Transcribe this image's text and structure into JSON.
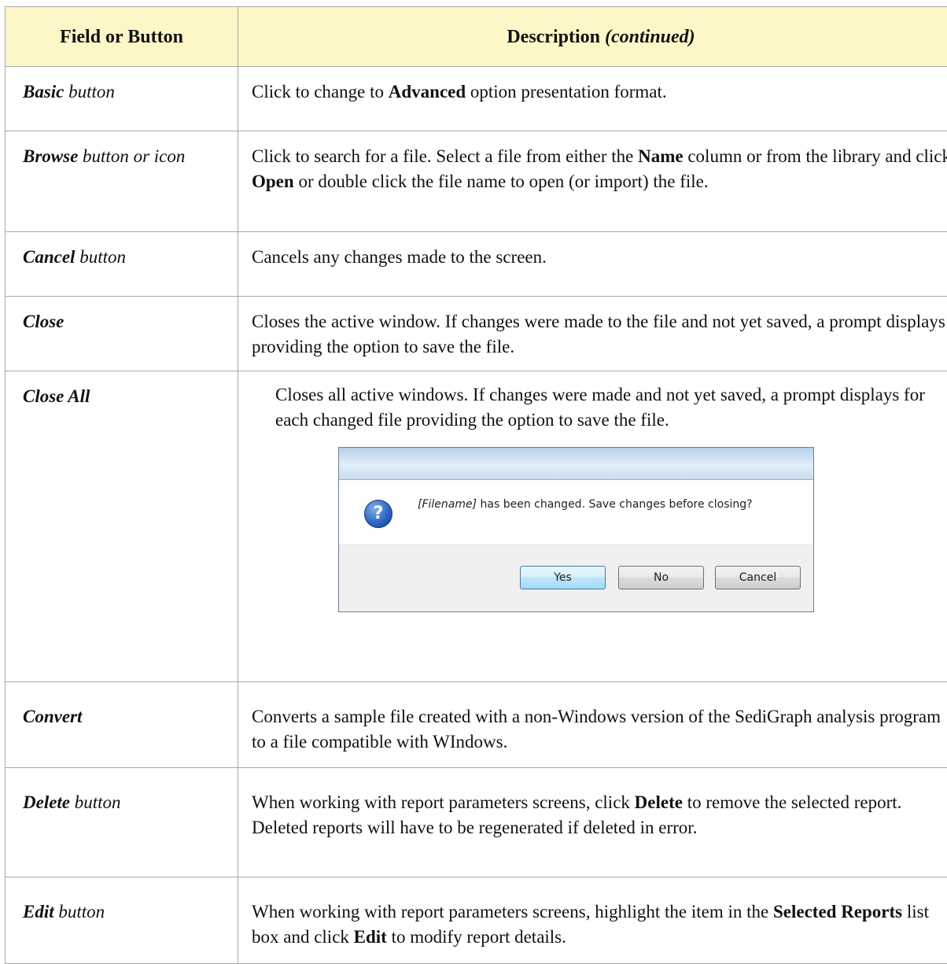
{
  "header": {
    "col1": "Field or Button",
    "col2_main": "Description ",
    "col2_italic": "(continued)"
  },
  "rows": [
    {
      "field_bold": "Basic",
      "field_rest": " button",
      "desc": [
        {
          "t": "Click to change to "
        },
        {
          "t": "Advanced",
          "b": true
        },
        {
          "t": " option presentation format."
        }
      ]
    },
    {
      "field_bold": "Browse",
      "field_rest": " button or icon",
      "desc": [
        {
          "t": "Click to search for a file. Select a file from either the "
        },
        {
          "t": "Name",
          "b": true
        },
        {
          "t": " column or from the library and click "
        },
        {
          "t": "Open",
          "b": true
        },
        {
          "t": " or double click the file name to open (or import) the file."
        }
      ]
    },
    {
      "field_bold": "Cancel",
      "field_rest": " button",
      "desc": [
        {
          "t": "Cancels any changes made to the screen."
        }
      ]
    },
    {
      "field_bold": "Close",
      "field_rest": "",
      "desc": [
        {
          "t": "Closes the active window. If changes were made to the file and not yet saved, a prompt displays providing the option to save the file."
        }
      ]
    },
    {
      "field_bold": "Close All",
      "field_rest": "",
      "desc": [
        {
          "t": "Closes all active windows. If changes were made and not yet saved, a prompt displays for each changed file providing the option to save the file."
        }
      ]
    },
    {
      "field_bold": "Convert",
      "field_rest": "",
      "desc": [
        {
          "t": "Converts a sample file created with a non-Windows version of the SediGraph analysis program to a file compatible with WIndows."
        }
      ]
    },
    {
      "field_bold": "Delete",
      "field_rest": " button",
      "desc": [
        {
          "t": "When working with report parameters screens, click "
        },
        {
          "t": "Delete",
          "b": true
        },
        {
          "t": " to remove the selected report. Deleted reports will have to be regenerated if deleted in error."
        }
      ]
    },
    {
      "field_bold": "Edit",
      "field_rest": " button",
      "desc": [
        {
          "t": "When working with report parameters screens, highlight the item in the "
        },
        {
          "t": "Selected Reports",
          "b": true
        },
        {
          "t": " list box and click "
        },
        {
          "t": "Edit",
          "b": true
        },
        {
          "t": " to modify report details."
        }
      ]
    }
  ],
  "dialog": {
    "message_italic": "[Filename]",
    "message_rest": " has been changed. Save changes before closing?",
    "icon": "question-icon",
    "icon_glyph": "?",
    "buttons": {
      "yes": "Yes",
      "no": "No",
      "cancel": "Cancel"
    }
  },
  "colors": {
    "header_bg": "#fdf7c8",
    "border": "#a8a8a8"
  }
}
